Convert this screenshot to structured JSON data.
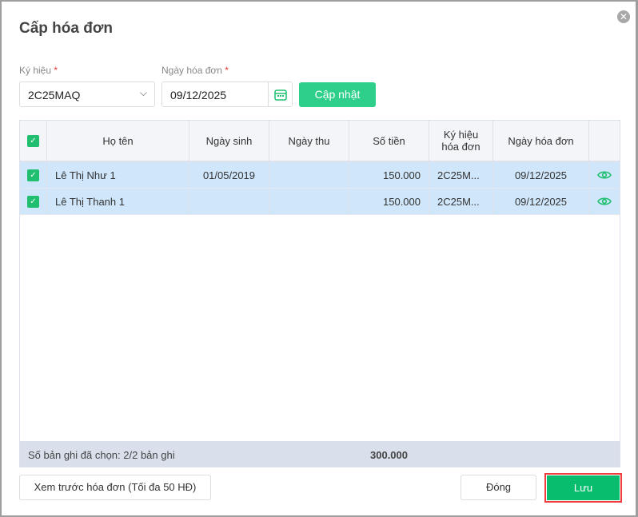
{
  "dialog": {
    "title": "Cấp hóa đơn"
  },
  "form": {
    "symbol_label": "Ký hiệu",
    "symbol_value": "2C25MAQ",
    "date_label": "Ngày hóa đơn",
    "date_value": "09/12/2025",
    "required_mark": "*",
    "update_label": "Cập nhật"
  },
  "table": {
    "headers": [
      "Họ tên",
      "Ngày sinh",
      "Ngày thu",
      "Số tiền",
      "Ký hiệu hóa đơn",
      "Ngày hóa đơn"
    ],
    "rows": [
      {
        "name": "Lê Thị Như 1",
        "dob": "01/05/2019",
        "paid_date": "",
        "amount": "150.000",
        "symbol": "2C25M...",
        "invoice_date": "09/12/2025"
      },
      {
        "name": "Lê Thị Thanh 1",
        "dob": "",
        "paid_date": "",
        "amount": "150.000",
        "symbol": "2C25M...",
        "invoice_date": "09/12/2025"
      }
    ],
    "footer_count": "Số bản ghi đã chọn: 2/2 bản ghi",
    "footer_total": "300.000"
  },
  "buttons": {
    "preview": "Xem trước hóa đơn (Tối đa 50 HĐ)",
    "close": "Đóng",
    "save": "Lưu"
  },
  "colors": {
    "accent": "#08bd6e",
    "selected_row": "#cfe6fb"
  }
}
